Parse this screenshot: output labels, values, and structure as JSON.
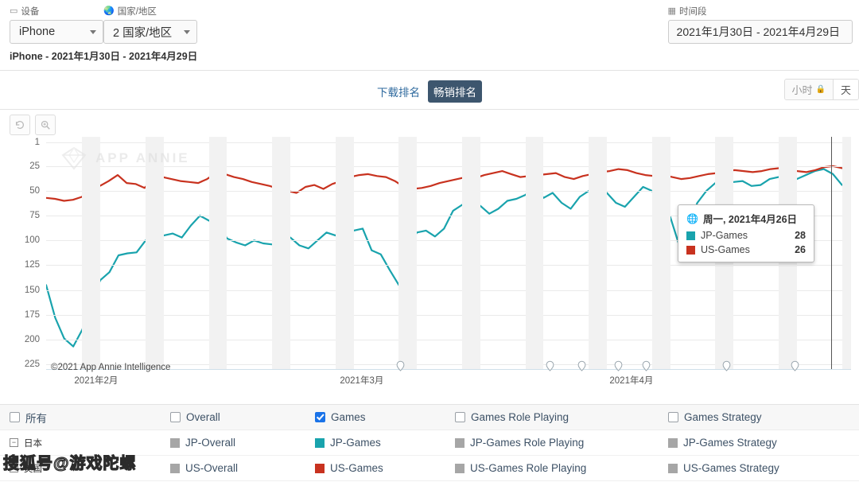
{
  "filters": {
    "device": {
      "label": "设备",
      "icon": "device-icon",
      "value": "iPhone"
    },
    "country": {
      "label": "国家/地区",
      "icon": "globe-icon",
      "value": "2 国家/地区"
    },
    "daterange": {
      "label": "时间段",
      "icon": "calendar-icon",
      "value": "2021年1月30日 - 2021年4月29日"
    }
  },
  "subtitle": "iPhone - 2021年1月30日 - 2021年4月29日",
  "tabs": {
    "download_rank": "下载排名",
    "grossing_rank": "畅销排名",
    "active": "畅销排名"
  },
  "granularity": {
    "hour": "小时",
    "hour_locked_icon": "lock-icon",
    "day": "天"
  },
  "chart_tools": {
    "reset": "reset-icon",
    "zoom": "zoom-in-icon"
  },
  "tooltip": {
    "icon": "globe-icon",
    "date": "周一, 2021年4月26日",
    "rows": [
      {
        "name": "JP-Games",
        "value": "28",
        "color": "#19a3ad"
      },
      {
        "name": "US-Games",
        "value": "26",
        "color": "#c8321f"
      }
    ]
  },
  "watermarks": {
    "brand": "APP ANNIE",
    "copyright": "©2021 App Annie Intelligence",
    "site": "搜狐号@游戏陀螺"
  },
  "legend": {
    "header": [
      {
        "label": "所有",
        "checked": false
      },
      {
        "label": "Overall",
        "checked": false
      },
      {
        "label": "Games",
        "checked": true
      },
      {
        "label": "Games Role Playing",
        "checked": false
      },
      {
        "label": "Games Strategy",
        "checked": false
      }
    ],
    "rows": [
      {
        "country": "日本",
        "collapse": "−",
        "series": [
          {
            "label": "JP-Overall",
            "color": "#a6a6a6"
          },
          {
            "label": "JP-Games",
            "color": "#19a3ad"
          },
          {
            "label": "JP-Games Role Playing",
            "color": "#a6a6a6"
          },
          {
            "label": "JP-Games Strategy",
            "color": "#a6a6a6"
          }
        ]
      },
      {
        "country": "美国",
        "collapse": "−",
        "series": [
          {
            "label": "US-Overall",
            "color": "#a6a6a6"
          },
          {
            "label": "US-Games",
            "color": "#c8321f"
          },
          {
            "label": "US-Games Role Playing",
            "color": "#a6a6a6"
          },
          {
            "label": "US-Games Strategy",
            "color": "#a6a6a6"
          }
        ]
      }
    ]
  },
  "chart_data": {
    "type": "line",
    "title": "",
    "xlabel": "",
    "ylabel": "",
    "ylim": [
      1,
      225
    ],
    "y_inverted": true,
    "grid": true,
    "yticks": [
      1,
      25,
      50,
      75,
      100,
      125,
      150,
      175,
      200,
      225
    ],
    "xticks": [
      "2021年2月",
      "2021年3月",
      "2021年4月"
    ],
    "xtick_positions": [
      0.035,
      0.365,
      0.7
    ],
    "x_start": "2021年1月30日",
    "x_end": "2021年4月29日",
    "n_points": 90,
    "series": [
      {
        "name": "JP-Games",
        "color": "#19a3ad",
        "values": [
          145,
          178,
          199,
          207,
          190,
          160,
          140,
          132,
          115,
          113,
          112,
          100,
          92,
          95,
          93,
          97,
          85,
          75,
          80,
          82,
          98,
          102,
          105,
          100,
          103,
          104,
          99,
          97,
          105,
          108,
          100,
          92,
          95,
          86,
          90,
          88,
          110,
          114,
          130,
          145,
          106,
          92,
          90,
          96,
          88,
          70,
          64,
          62,
          65,
          73,
          68,
          60,
          58,
          54,
          46,
          57,
          52,
          62,
          68,
          56,
          50,
          48,
          52,
          62,
          66,
          56,
          46,
          50,
          60,
          76,
          105,
          85,
          62,
          50,
          42,
          44,
          41,
          40,
          45,
          44,
          38,
          36,
          35,
          38,
          34,
          30,
          28,
          33,
          44,
          38
        ]
      },
      {
        "name": "US-Games",
        "color": "#c8321f",
        "values": [
          57,
          58,
          60,
          59,
          56,
          48,
          45,
          40,
          34,
          42,
          43,
          47,
          38,
          36,
          38,
          40,
          41,
          42,
          38,
          32,
          33,
          36,
          38,
          41,
          43,
          45,
          48,
          50,
          52,
          46,
          44,
          48,
          43,
          40,
          36,
          34,
          33,
          35,
          36,
          40,
          46,
          48,
          47,
          45,
          42,
          40,
          38,
          36,
          37,
          34,
          32,
          30,
          33,
          36,
          35,
          34,
          33,
          32,
          36,
          38,
          35,
          33,
          31,
          30,
          28,
          29,
          32,
          34,
          35,
          34,
          36,
          38,
          37,
          35,
          33,
          32,
          30,
          29,
          30,
          31,
          30,
          28,
          27,
          28,
          30,
          31,
          29,
          26,
          25,
          27,
          26
        ]
      }
    ],
    "crosshair": {
      "date": "2021年4月26日",
      "x_fraction": 0.975
    },
    "weekend_bands": true,
    "event_markers": {
      "icon": "pin-icon",
      "count": 7,
      "x_fractions": [
        0.44,
        0.625,
        0.665,
        0.71,
        0.745,
        0.845,
        0.93
      ]
    }
  }
}
